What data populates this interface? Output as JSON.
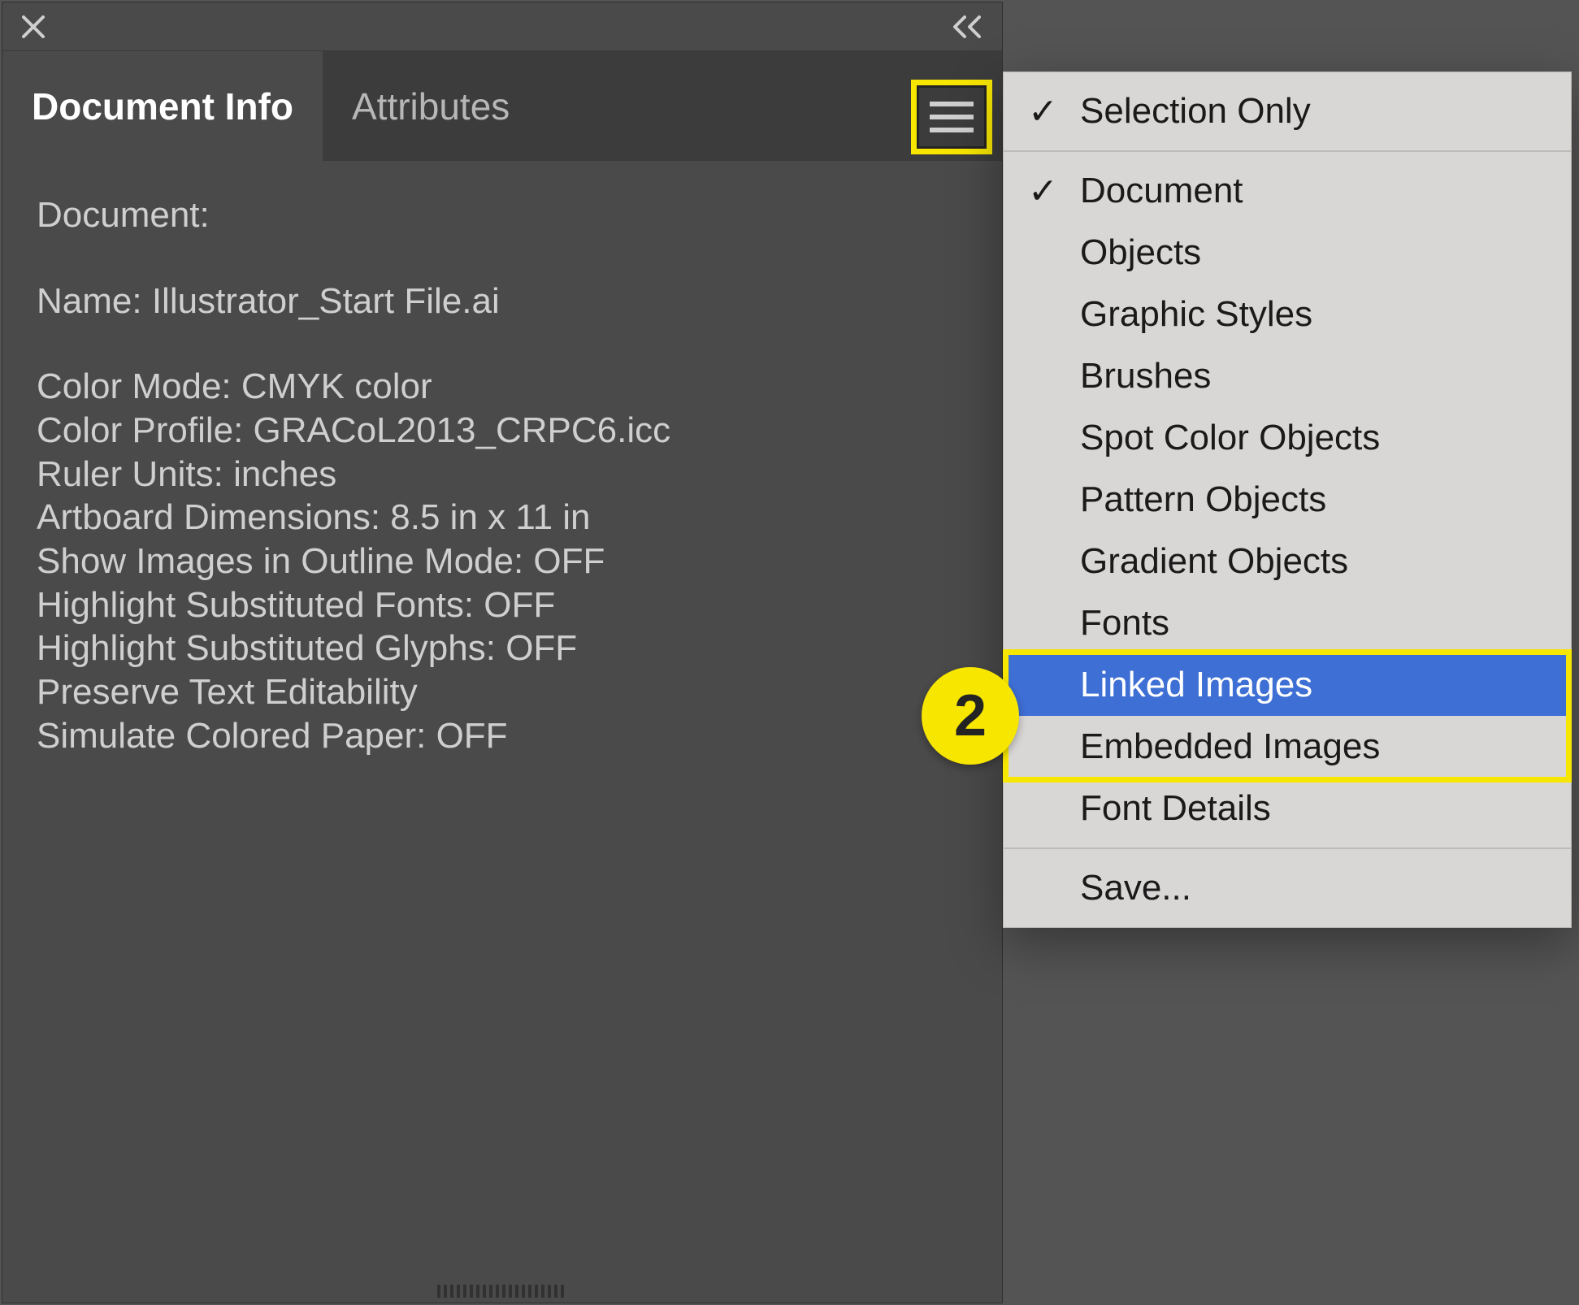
{
  "panel": {
    "tabs": {
      "document_info": "Document Info",
      "attributes": "Attributes"
    },
    "section_label": "Document:",
    "name_line": "Name: Illustrator_Start File.ai",
    "lines": [
      "Color Mode: CMYK color",
      "Color Profile: GRACoL2013_CRPC6.icc",
      "Ruler Units: inches",
      "Artboard Dimensions: 8.5 in x 11 in",
      "Show Images in Outline Mode: OFF",
      "Highlight Substituted Fonts: OFF",
      "Highlight Substituted Glyphs: OFF",
      "Preserve Text Editability",
      "Simulate Colored Paper: OFF"
    ]
  },
  "menu": {
    "group1": [
      {
        "label": "Selection Only",
        "checked": true
      }
    ],
    "group2": [
      {
        "label": "Document",
        "checked": true
      },
      {
        "label": "Objects",
        "checked": false
      },
      {
        "label": "Graphic Styles",
        "checked": false
      },
      {
        "label": "Brushes",
        "checked": false
      },
      {
        "label": "Spot Color Objects",
        "checked": false
      },
      {
        "label": "Pattern Objects",
        "checked": false
      },
      {
        "label": "Gradient Objects",
        "checked": false
      },
      {
        "label": "Fonts",
        "checked": false
      },
      {
        "label": "Linked Images",
        "checked": false,
        "highlighted": true
      },
      {
        "label": "Embedded Images",
        "checked": false
      },
      {
        "label": "Font Details",
        "checked": false
      }
    ],
    "group3": [
      {
        "label": "Save...",
        "checked": false
      }
    ]
  },
  "annotations": {
    "badge2": "2"
  }
}
